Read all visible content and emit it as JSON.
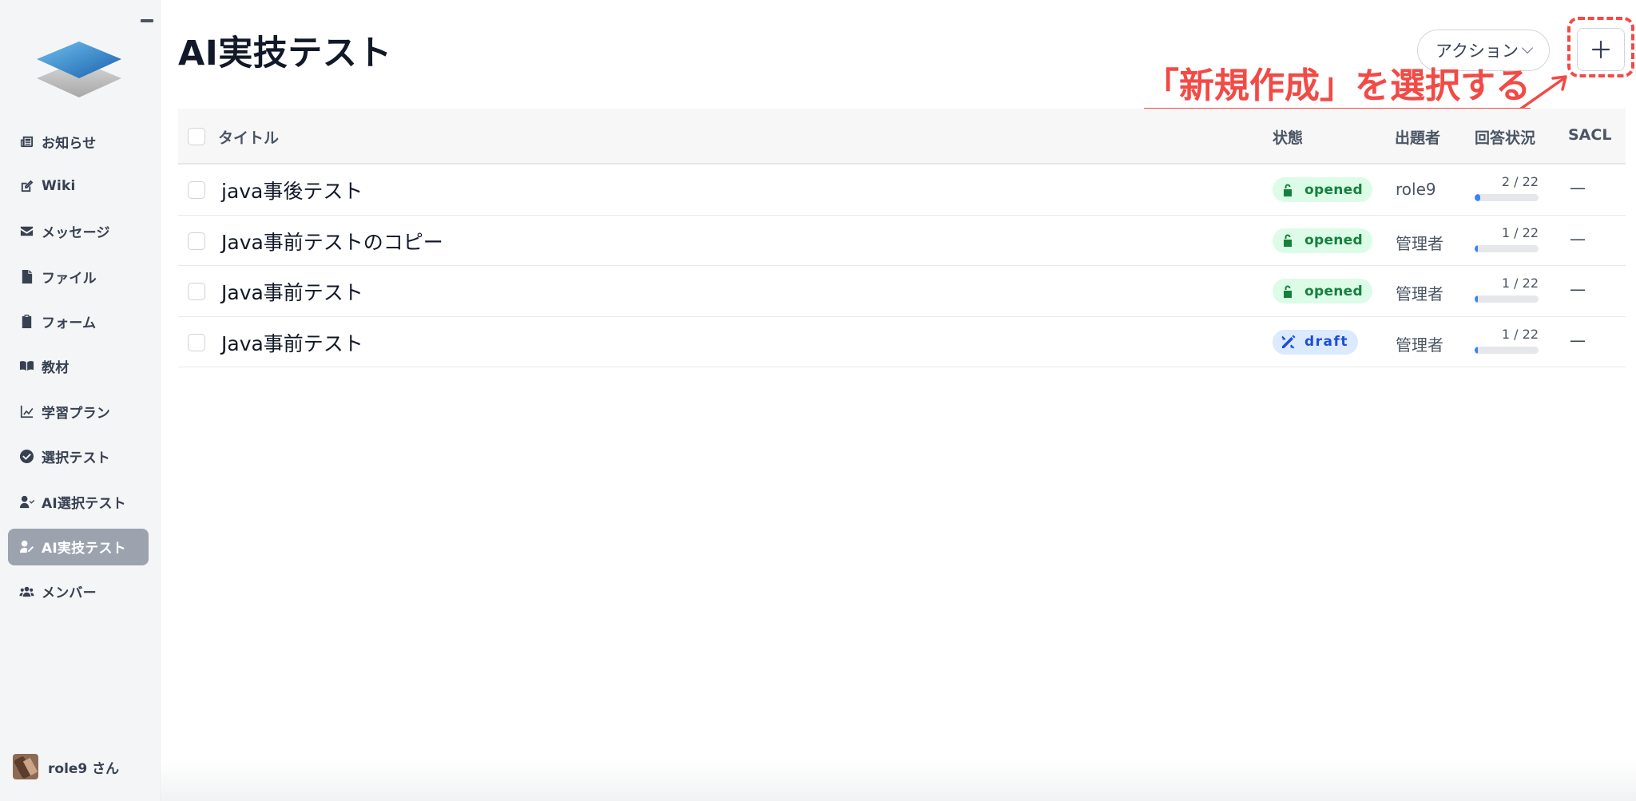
{
  "sidebar": {
    "items": [
      {
        "label": "お知らせ",
        "icon": "newspaper-icon",
        "active": false
      },
      {
        "label": "Wiki",
        "icon": "edit-icon",
        "active": false
      },
      {
        "label": "メッセージ",
        "icon": "envelope-icon",
        "active": false
      },
      {
        "label": "ファイル",
        "icon": "file-icon",
        "active": false
      },
      {
        "label": "フォーム",
        "icon": "clipboard-icon",
        "active": false
      },
      {
        "label": "教材",
        "icon": "book-icon",
        "active": false
      },
      {
        "label": "学習プラン",
        "icon": "chart-line-icon",
        "active": false
      },
      {
        "label": "選択テスト",
        "icon": "check-circle-icon",
        "active": false
      },
      {
        "label": "AI選択テスト",
        "icon": "user-check-icon",
        "active": false
      },
      {
        "label": "AI実技テスト",
        "icon": "user-edit-icon",
        "active": true
      },
      {
        "label": "メンバー",
        "icon": "users-icon",
        "active": false
      }
    ],
    "user": {
      "name": "role9 さん"
    }
  },
  "header": {
    "title": "AI実技テスト",
    "action_label": "アクション",
    "new_button_symbol": "+"
  },
  "annotation": {
    "text": "「新規作成」を選択する",
    "color": "#f24a45"
  },
  "table": {
    "columns": {
      "title": "タイトル",
      "status": "状態",
      "author": "出題者",
      "progress": "回答状況",
      "sacl": "SACL"
    },
    "rows": [
      {
        "title": "java事後テスト",
        "status": "opened",
        "author": "role9",
        "progress_text": "2 / 22",
        "answered": 2,
        "total": 22,
        "sacl": "—"
      },
      {
        "title": "Java事前テストのコピー",
        "status": "opened",
        "author": "管理者",
        "progress_text": "1 / 22",
        "answered": 1,
        "total": 22,
        "sacl": "—"
      },
      {
        "title": "Java事前テスト",
        "status": "opened",
        "author": "管理者",
        "progress_text": "1 / 22",
        "answered": 1,
        "total": 22,
        "sacl": "—"
      },
      {
        "title": "Java事前テスト",
        "status": "draft",
        "author": "管理者",
        "progress_text": "1 / 22",
        "answered": 1,
        "total": 22,
        "sacl": "—"
      }
    ]
  },
  "colors": {
    "opened_bg": "#dcfce7",
    "opened_fg": "#15803d",
    "draft_bg": "#dbeafe",
    "draft_fg": "#1d4ed8",
    "progress_fill": "#3b82f6",
    "active_nav_bg": "#9ca3af"
  }
}
